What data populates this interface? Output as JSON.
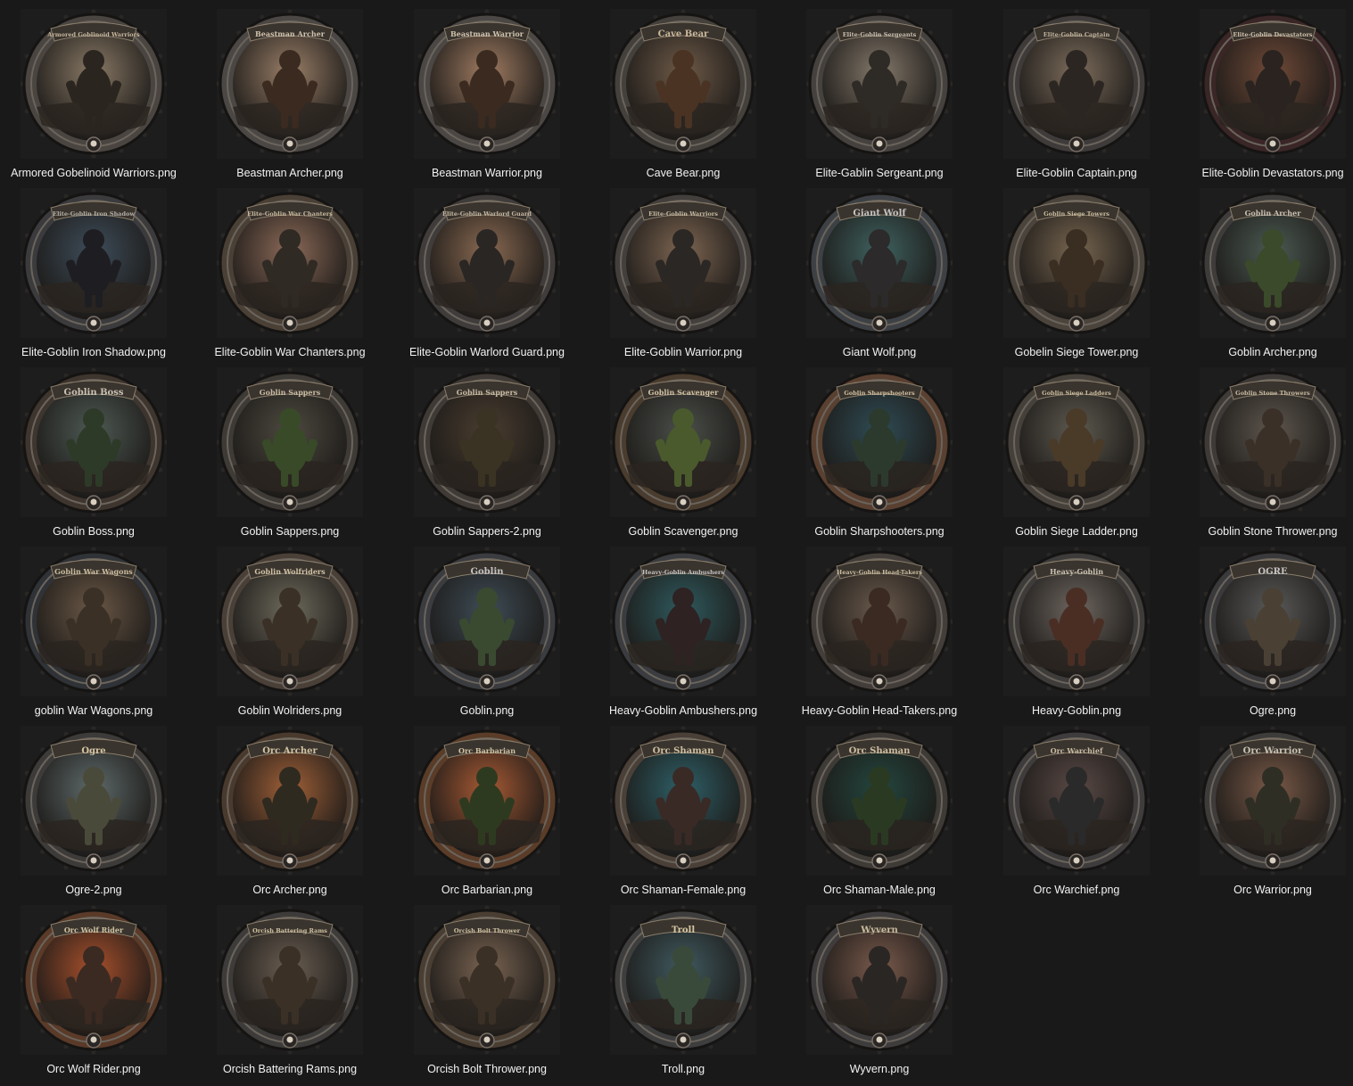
{
  "window": {
    "view": "Large icons"
  },
  "files": [
    {
      "name": "Armored Gobelinoid Warriors.png",
      "banner": "Armored Goblinoid Warriors",
      "frame": "#4a4540",
      "sky": "#8a7a66",
      "accent": "#c6b79e",
      "figure": "#2b2520"
    },
    {
      "name": "Beastman Archer.png",
      "banner": "Beastman Archer",
      "frame": "#4b4744",
      "sky": "#9a7f68",
      "accent": "#d0c3ae",
      "figure": "#3a2a20"
    },
    {
      "name": "Beastman Warrior.png",
      "banner": "Beastman Warrior",
      "frame": "#4b4744",
      "sky": "#a07c62",
      "accent": "#d0c3ae",
      "figure": "#3a2a20"
    },
    {
      "name": "Cave Bear.png",
      "banner": "Cave Bear",
      "frame": "#44403c",
      "sky": "#6e5a48",
      "accent": "#cbb99c",
      "figure": "#4a3322"
    },
    {
      "name": "Elite-Gablin Sergeant.png",
      "banner": "Elite-Goblin Sergeants",
      "frame": "#45413e",
      "sky": "#84786a",
      "accent": "#c9c0b0",
      "figure": "#2e2a26"
    },
    {
      "name": "Elite-Goblin Captain.png",
      "banner": "Elite-Goblin Captain",
      "frame": "#3e3b3a",
      "sky": "#7d6d5c",
      "accent": "#c3b59e",
      "figure": "#2c2622"
    },
    {
      "name": "Elite-Goblin Devastators.png",
      "banner": "Elite-Goblin Devastators",
      "frame": "#3a2626",
      "sky": "#704a38",
      "accent": "#cfc3ae",
      "figure": "#2a2320"
    },
    {
      "name": "Elite-Goblin Iron Shadow.png",
      "banner": "Elite-Goblin Iron Shadow",
      "frame": "#3b3b3d",
      "sky": "#3e4d5a",
      "accent": "#b4b0a8",
      "figure": "#1e1e22"
    },
    {
      "name": "Elite-Goblin War Chanters.png",
      "banner": "Elite-Goblin War Chanters",
      "frame": "#4a4036",
      "sky": "#8c6a58",
      "accent": "#cabb9f",
      "figure": "#2f2a24"
    },
    {
      "name": "Elite-Goblin Warlord Guard.png",
      "banner": "Elite-Goblin Warlord Guard",
      "frame": "#3f3c3b",
      "sky": "#8a6a52",
      "accent": "#c6b9a2",
      "figure": "#2a2624"
    },
    {
      "name": "Elite-Goblin Warrior.png",
      "banner": "Elite-Goblin Warriors",
      "frame": "#433f3c",
      "sky": "#7e6652",
      "accent": "#c8bba3",
      "figure": "#2b2724"
    },
    {
      "name": "Giant Wolf.png",
      "banner": "Giant Wolf",
      "frame": "#3d4145",
      "sky": "#3f6260",
      "accent": "#c4c4c4",
      "figure": "#2c2a2a"
    },
    {
      "name": "Gobelin Siege Tower.png",
      "banner": "Goblin Siege Towers",
      "frame": "#4a443c",
      "sky": "#786650",
      "accent": "#cbbd9e",
      "figure": "#3a2d22"
    },
    {
      "name": "Goblin Archer.png",
      "banner": "Goblin Archer",
      "frame": "#3d3c3a",
      "sky": "#4c5a52",
      "accent": "#c8c2b4",
      "figure": "#3a4a2a"
    },
    {
      "name": "Goblin Boss.png",
      "banner": "Goblin Boss",
      "frame": "#3e352e",
      "sky": "#4f5a55",
      "accent": "#c8c2b4",
      "figure": "#2e3a28"
    },
    {
      "name": "Goblin Sappers.png",
      "banner": "Goblin Sappers",
      "frame": "#3e3a36",
      "sky": "#4e4a40",
      "accent": "#c8bba3",
      "figure": "#384a28"
    },
    {
      "name": "Goblin Sappers-2.png",
      "banner": "Goblin Sappers",
      "frame": "#3f3a35",
      "sky": "#4a3d30",
      "accent": "#c8bba3",
      "figure": "#3a3222"
    },
    {
      "name": "Goblin Scavenger.png",
      "banner": "Goblin Scavenger",
      "frame": "#4a3c2e",
      "sky": "#4b4f4a",
      "accent": "#d2c4a6",
      "figure": "#4a5a2c"
    },
    {
      "name": "Goblin Sharpshooters.png",
      "banner": "Goblin Sharpshooters",
      "frame": "#5a4030",
      "sky": "#2f4c55",
      "accent": "#d1c2a2",
      "figure": "#2c3a2e"
    },
    {
      "name": "Goblin Siege Ladder.png",
      "banner": "Goblin Siege Ladders",
      "frame": "#45403a",
      "sky": "#5e5a50",
      "accent": "#cbbd9e",
      "figure": "#4a3a28"
    },
    {
      "name": "Goblin Stone Thrower.png",
      "banner": "Goblin Stone Throwers",
      "frame": "#3e3a37",
      "sky": "#5e574e",
      "accent": "#c8bba3",
      "figure": "#3a3028"
    },
    {
      "name": "goblin War Wagons.png",
      "banner": "Goblin War Wagons",
      "frame": "#2f3236",
      "sky": "#6b5846",
      "accent": "#cbbd9e",
      "figure": "#3a3026"
    },
    {
      "name": "Goblin Wolriders.png",
      "banner": "Goblin Wolfriders",
      "frame": "#4a4038",
      "sky": "#6e6a5c",
      "accent": "#d1c3a6",
      "figure": "#3a3026"
    },
    {
      "name": "Goblin.png",
      "banner": "Goblin",
      "frame": "#3a3c40",
      "sky": "#3e4c56",
      "accent": "#c3c3c3",
      "figure": "#3a4a30"
    },
    {
      "name": "Heavy-Goblin Ambushers.png",
      "banner": "Heavy-Goblin Ambushers",
      "frame": "#3a3c3f",
      "sky": "#2f5a5e",
      "accent": "#c3c3c3",
      "figure": "#2e2222"
    },
    {
      "name": "Heavy-Goblin Head-Takers.png",
      "banner": "Heavy-Goblin Head-Takers",
      "frame": "#433e3a",
      "sky": "#6a5a4c",
      "accent": "#cbbd9e",
      "figure": "#3a2a22"
    },
    {
      "name": "Heavy-Goblin.png",
      "banner": "Heavy-Goblin",
      "frame": "#3e3c3a",
      "sky": "#6e6660",
      "accent": "#c8c2b4",
      "figure": "#4a2e24"
    },
    {
      "name": "Ogre.png",
      "banner": "OGRE",
      "frame": "#3a3a3c",
      "sky": "#5a5a58",
      "accent": "#c3c3c3",
      "figure": "#4a4034"
    },
    {
      "name": "Ogre-2.png",
      "banner": "Ogre",
      "frame": "#3d3b39",
      "sky": "#5e6a6a",
      "accent": "#d6c7a4",
      "figure": "#4a4a3a"
    },
    {
      "name": "Orc Archer.png",
      "banner": "Orc Archer",
      "frame": "#4a3a2e",
      "sky": "#a06038",
      "accent": "#d1c2a2",
      "figure": "#2e2a20"
    },
    {
      "name": "Orc Barbarian.png",
      "banner": "Orc Barbarian",
      "frame": "#5a3c28",
      "sky": "#a85a34",
      "accent": "#d1c2a2",
      "figure": "#2e3a20"
    },
    {
      "name": "Orc Shaman-Female.png",
      "banner": "Orc Shaman",
      "frame": "#4a4038",
      "sky": "#2e6068",
      "accent": "#cbbd9e",
      "figure": "#3a2a26"
    },
    {
      "name": "Orc Shaman-Male.png",
      "banner": "Orc Shaman",
      "frame": "#3e3a36",
      "sky": "#24463e",
      "accent": "#cbbd9e",
      "figure": "#2a3a22"
    },
    {
      "name": "Orc Warchief.png",
      "banner": "Orc Warchief",
      "frame": "#3e3c3c",
      "sky": "#5a4a46",
      "accent": "#c8bba3",
      "figure": "#2a2a2a"
    },
    {
      "name": "Orc Warrior.png",
      "banner": "Orc Warrior",
      "frame": "#3e3c3a",
      "sky": "#7a5a48",
      "accent": "#c8c2b4",
      "figure": "#2e2e24"
    },
    {
      "name": "Orc Wolf Rider.png",
      "banner": "Orc Wolf Rider",
      "frame": "#5a3a28",
      "sky": "#a8502c",
      "accent": "#d1c2a2",
      "figure": "#3a2a22"
    },
    {
      "name": "Orcish Battering Rams.png",
      "banner": "Orcish Battering Rams",
      "frame": "#3e3c3a",
      "sky": "#6a5e52",
      "accent": "#d1c2a2",
      "figure": "#3a3026"
    },
    {
      "name": "Orcish Bolt Thrower.png",
      "banner": "Orcish Bolt Thrower",
      "frame": "#4a3e32",
      "sky": "#7a6452",
      "accent": "#d1c2a2",
      "figure": "#3a3026"
    },
    {
      "name": "Troll.png",
      "banner": "Troll",
      "frame": "#3e3e3e",
      "sky": "#405a60",
      "accent": "#d6c7a4",
      "figure": "#3a4a3a"
    },
    {
      "name": "Wyvern.png",
      "banner": "Wyvern",
      "frame": "#3e3c3c",
      "sky": "#7a5a4c",
      "accent": "#cbbd9e",
      "figure": "#2a2624"
    }
  ]
}
